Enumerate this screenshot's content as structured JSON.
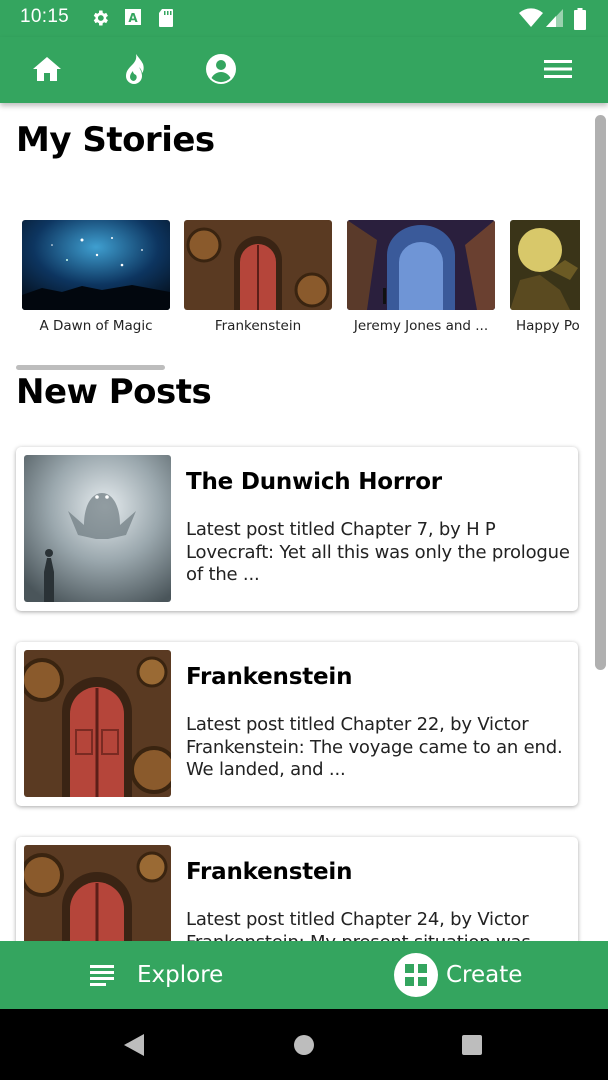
{
  "status_bar": {
    "time": "10:15",
    "left_icons": [
      "gear-icon",
      "a-box-icon",
      "sd-card-icon"
    ],
    "right_icons": [
      "wifi-icon",
      "signal-icon",
      "battery-icon"
    ]
  },
  "app_bar": {
    "icons": [
      "home-icon",
      "fire-icon",
      "profile-icon",
      "menu-icon"
    ]
  },
  "sections": {
    "my_stories": "My Stories",
    "new_posts": "New Posts"
  },
  "stories": [
    {
      "title": "A Dawn of Magic"
    },
    {
      "title": "Frankenstein"
    },
    {
      "title": "Jeremy Jones and ..."
    },
    {
      "title": "Happy Po"
    }
  ],
  "posts": [
    {
      "title": "The Dunwich Horror",
      "description": "Latest post titled Chapter 7, by H P Lovecraft: Yet all this was only the prologue of the ..."
    },
    {
      "title": "Frankenstein",
      "description": "Latest post titled Chapter 22, by Victor Frankenstein: The voyage came to an end. We landed, and ..."
    },
    {
      "title": "Frankenstein",
      "description": "Latest post titled Chapter 24, by Victor Frankenstein: My present situation was"
    }
  ],
  "bottom_bar": {
    "explore_label": "Explore",
    "create_label": "Create"
  },
  "colors": {
    "primary_green": "#34a55f",
    "white": "#ffffff"
  }
}
